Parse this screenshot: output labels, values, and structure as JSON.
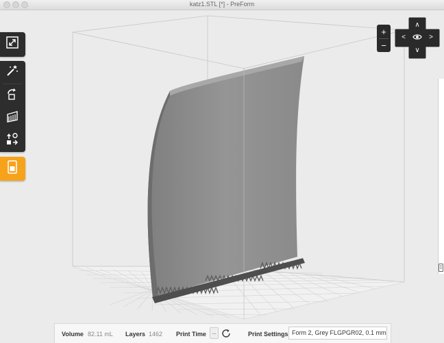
{
  "window": {
    "title": "katz1.STL [*] - PreForm"
  },
  "toolbar": {
    "tools": [
      {
        "name": "layout",
        "icon": "resize-icon"
      },
      {
        "name": "wand",
        "icon": "magic-wand-icon"
      },
      {
        "name": "orientation",
        "icon": "rotate-icon"
      },
      {
        "name": "supports",
        "icon": "supports-icon"
      },
      {
        "name": "arrange",
        "icon": "arrange-icon"
      }
    ],
    "job_icon": "print-job-icon"
  },
  "view_controls": {
    "zoom_in": "+",
    "zoom_out": "−",
    "up": "∧",
    "down": "∨",
    "left": "<",
    "right": ">",
    "center_icon": "eye-icon"
  },
  "status": {
    "volume_label": "Volume",
    "volume_value": "82.11 mL",
    "layers_label": "Layers",
    "layers_value": "1462",
    "print_time_label": "Print Time",
    "print_time_value": "--",
    "print_settings_label": "Print Settings",
    "print_settings_value": "Form 2, Grey FLGPGR02, 0.1 mm"
  },
  "colors": {
    "background": "#ebebeb",
    "model": "#8e8e8e",
    "toolbar": "#2d2d2d",
    "accent": "#f7a21b"
  }
}
